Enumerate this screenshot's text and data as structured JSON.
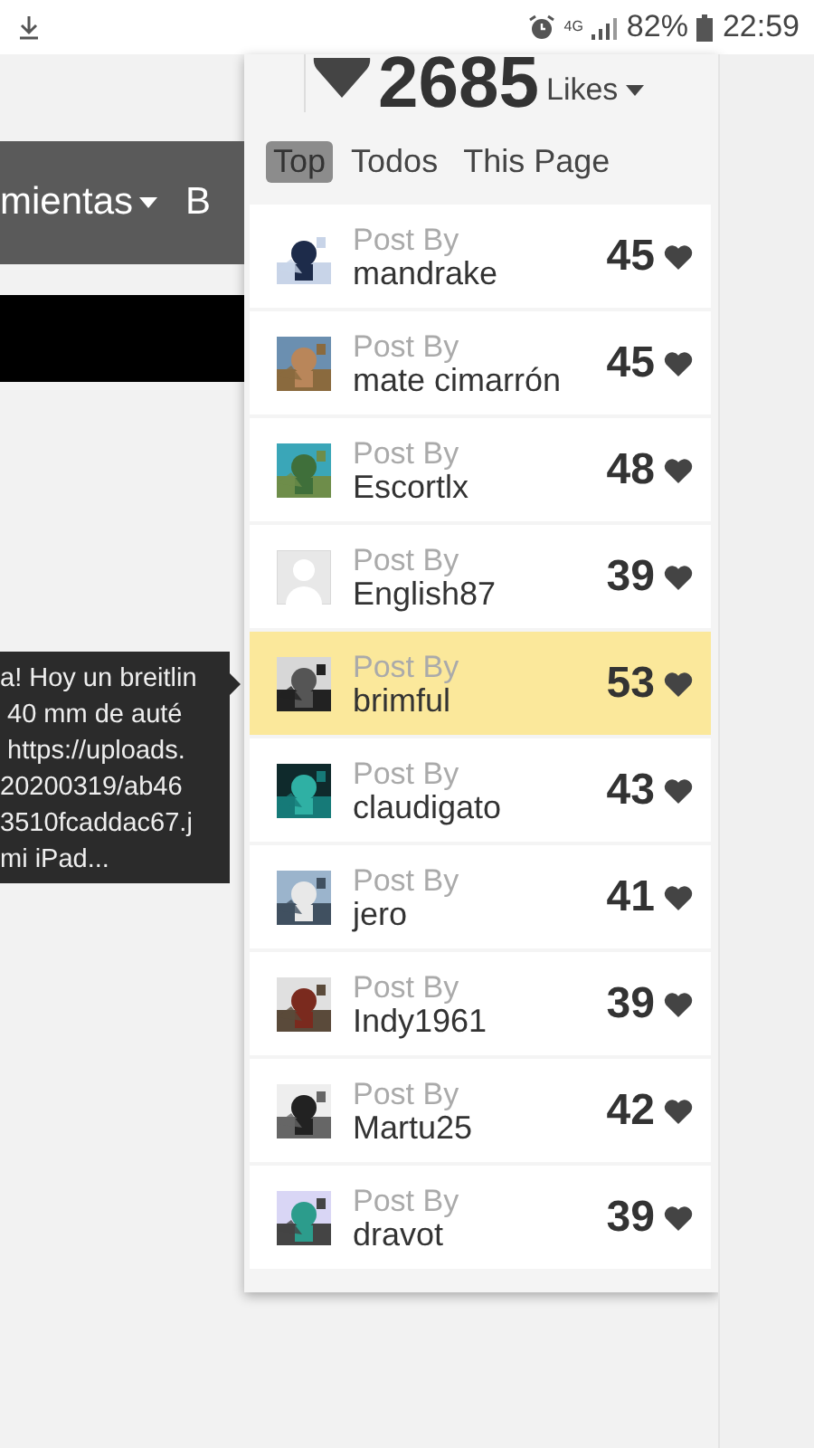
{
  "status_bar": {
    "network": "4G",
    "battery": "82%",
    "time": "22:59"
  },
  "nav": {
    "label": "mientas",
    "next": "B"
  },
  "tooltip": {
    "text": "a! Hoy un breitlin\n 40 mm de auté\n https://uploads.\n20200319/ab46\n3510fcaddac67.j\nmi iPad..."
  },
  "likes": {
    "count": "2685",
    "label": "Likes"
  },
  "tabs": [
    {
      "label": "Top",
      "selected": true
    },
    {
      "label": "Todos",
      "selected": false
    },
    {
      "label": "This Page",
      "selected": false
    }
  ],
  "posts": [
    {
      "prefix": "Post By",
      "user": "mandrake",
      "count": "45",
      "highlighted": false,
      "kind": "picture"
    },
    {
      "prefix": "Post By",
      "user": "mate cimarrón",
      "count": "45",
      "highlighted": false,
      "kind": "picture"
    },
    {
      "prefix": "Post By",
      "user": "Escortlx",
      "count": "48",
      "highlighted": false,
      "kind": "picture"
    },
    {
      "prefix": "Post By",
      "user": "English87",
      "count": "39",
      "highlighted": false,
      "kind": "default"
    },
    {
      "prefix": "Post By",
      "user": "brimful",
      "count": "53",
      "highlighted": true,
      "kind": "picture"
    },
    {
      "prefix": "Post By",
      "user": "claudigato",
      "count": "43",
      "highlighted": false,
      "kind": "picture"
    },
    {
      "prefix": "Post By",
      "user": "jero",
      "count": "41",
      "highlighted": false,
      "kind": "picture"
    },
    {
      "prefix": "Post By",
      "user": "Indy1961",
      "count": "39",
      "highlighted": false,
      "kind": "picture"
    },
    {
      "prefix": "Post By",
      "user": "Martu25",
      "count": "42",
      "highlighted": false,
      "kind": "picture"
    },
    {
      "prefix": "Post By",
      "user": "dravot",
      "count": "39",
      "highlighted": false,
      "kind": "picture"
    }
  ]
}
